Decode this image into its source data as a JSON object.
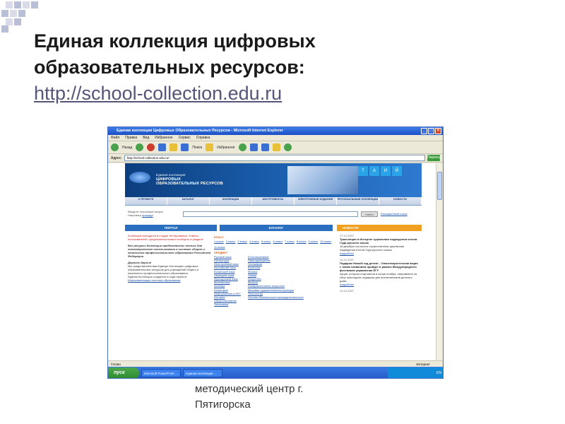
{
  "slide": {
    "title_line1": "Единая коллекция цифровых",
    "title_line2": "образовательных ресурсов:",
    "url": "http://school-collection.edu.ru",
    "footer_line1": "методический центр г.",
    "footer_line2": "Пятигорска"
  },
  "window": {
    "title": "Единая коллекция Цифровых Образовательных Ресурсов - Microsoft Internet Explorer",
    "menu": [
      "Файл",
      "Правка",
      "Вид",
      "Избранное",
      "Сервис",
      "Справка"
    ],
    "toolbar": {
      "back": "Назад",
      "search": "Поиск",
      "favorites": "Избранное"
    },
    "address_label": "Адрес:",
    "address_value": "http://school-collection.edu.ru/",
    "go_label": "Переход",
    "status_left": "Готово",
    "status_right": "Интернет"
  },
  "taskbar": {
    "start": "пуск",
    "tasks": [
      "Microsoft PowerPoint ...",
      "Единая коллекция ..."
    ],
    "tray_label": "EN"
  },
  "site": {
    "logo_line1": "Единая коллекция",
    "logo_line2": "ЦИФРОВЫХ",
    "logo_line3": "ОБРАЗОВАТЕЛЬНЫХ РЕСУРСОВ",
    "nav": [
      "О ПРОЕКТЕ",
      "КАТАЛОГ",
      "КОЛЛЕКЦИИ",
      "ИНСТРУМЕНТЫ",
      "ЭЛЕКТРОННЫЕ ИЗДАНИЯ",
      "РЕГИОНАЛЬНЫЕ КОЛЛЕКЦИИ",
      "НОВОСТИ"
    ],
    "search_label1": "Введите поисковый запрос",
    "search_label2": "Например",
    "search_example": "природа",
    "search_button": "Найти",
    "search_link": "Расширенный поиск",
    "col_portal": "ПОРТАЛ",
    "col_catalog": "КАТАЛОГ",
    "col_news": "НОВОСТИ",
    "left": {
      "p1": "Коллекция находится в стадии тестирования. Ответы пользователей, предложения можно сообщить в разделе",
      "p2": "Все ресурсы Коллекции предназначены только для некоммерческого использования в системе общего и начального профессионального образования Российской Федерации",
      "p3_title": "Дорогие друзья!",
      "p3": "Мы представляем вам Единую Коллекцию цифровых образовательных ресурсов для учреждений общего и начального профессионального образования.",
      "p4": "Единая Коллекция создается в ходе проекта",
      "p4_link": "Информатизация системы образования"
    },
    "catalog": {
      "class_title": "КЛАСС",
      "classes": [
        "1 класс",
        "2 класс",
        "3 класс",
        "4 класс",
        "5 класс",
        "6 класс",
        "7 класс",
        "8 класс",
        "9 класс",
        "10 класс",
        "11 класс"
      ],
      "subject_title": "ПРЕДМЕТ",
      "subjects_left": [
        "Русский язык",
        "Литература",
        "Иностранный язык",
        "Английский язык",
        "Испанский язык",
        "Немецкий язык",
        "Французский язык",
        "Математика",
        "Алгебра",
        "Геометрия",
        "Информатика и ИКТ",
        "История",
        "Обществознание",
        "Экономика"
      ],
      "subjects_right": [
        "Естествознание",
        "Природоведение",
        "География",
        "Биология",
        "Физика",
        "Химия",
        "Искусство",
        "Музыка",
        "Изобразительное искусство",
        "Мировая художественная культура",
        "Технология",
        "Основы безопасности жизнедеятельности"
      ]
    },
    "news": [
      {
        "date": "17.12.2007",
        "title": "Трансляция в Интернет церемонии подведения итогов Года русского языка",
        "text": "18 декабря состоится торжественная церемония подведения итогов Года русского языка",
        "link": "подробнее"
      },
      {
        "date": "14.12.2007",
        "title": "Подарим Новый год детям! – благотворительная акция с таким названием пройдет в рамках Международного фестиваля управления ЕГУ",
        "text": "Акция, которая стартовала в конце ноября, направлена на сбор новогодних подарков для воспитанников детского дома",
        "link": "подробнее"
      },
      {
        "date": "13.12.2007",
        "title": "",
        "text": "",
        "link": ""
      }
    ]
  }
}
